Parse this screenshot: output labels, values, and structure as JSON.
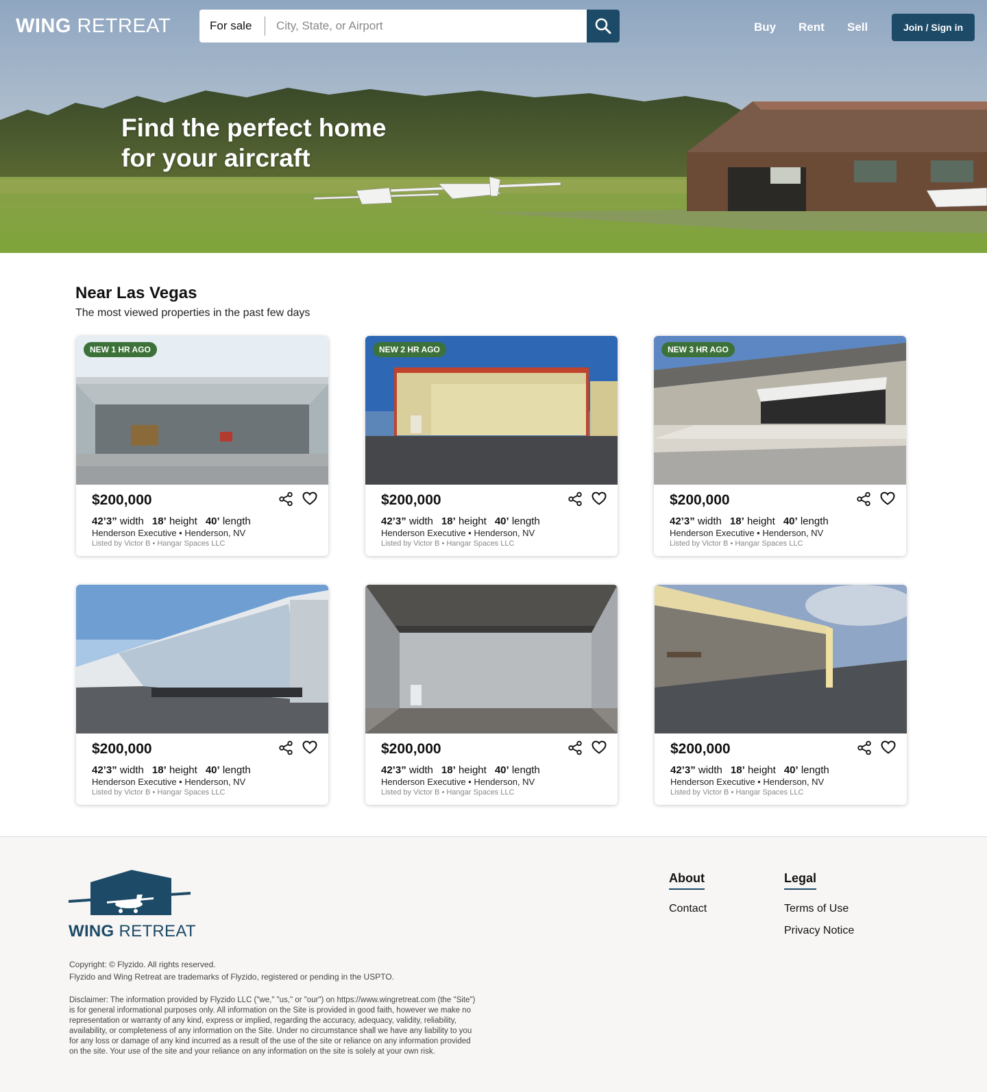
{
  "header": {
    "logo_part1": "WING",
    "logo_part2": "RETREAT",
    "search_mode": "For sale",
    "search_placeholder": "City, State, or Airport",
    "nav": [
      "Buy",
      "Rent",
      "Sell"
    ],
    "join_label": "Join / Sign in"
  },
  "hero": {
    "headline_line1": "Find the perfect home",
    "headline_line2": "for your aircraft"
  },
  "section": {
    "title": "Near Las Vegas",
    "subtitle": "The most viewed properties in the past few days"
  },
  "listings": [
    {
      "badge": "NEW 1 HR AGO",
      "price": "$200,000",
      "width": "42’3”",
      "width_label": "width",
      "height": "18’",
      "height_label": "height",
      "length": "40’",
      "length_label": "length",
      "location": "Henderson Executive • Henderson, NV",
      "lister": "Listed by Victor B • Hangar Spaces LLC"
    },
    {
      "badge": "NEW 2 HR AGO",
      "price": "$200,000",
      "width": "42’3”",
      "width_label": "width",
      "height": "18’",
      "height_label": "height",
      "length": "40’",
      "length_label": "length",
      "location": "Henderson Executive • Henderson, NV",
      "lister": "Listed by Victor B • Hangar Spaces LLC"
    },
    {
      "badge": "NEW 3 HR AGO",
      "price": "$200,000",
      "width": "42’3”",
      "width_label": "width",
      "height": "18’",
      "height_label": "height",
      "length": "40’",
      "length_label": "length",
      "location": "Henderson Executive • Henderson, NV",
      "lister": "Listed by Victor B • Hangar Spaces LLC"
    },
    {
      "badge": "",
      "price": "$200,000",
      "width": "42’3”",
      "width_label": "width",
      "height": "18’",
      "height_label": "height",
      "length": "40’",
      "length_label": "length",
      "location": "Henderson Executive • Henderson, NV",
      "lister": "Listed by Victor B • Hangar Spaces LLC"
    },
    {
      "badge": "",
      "price": "$200,000",
      "width": "42’3”",
      "width_label": "width",
      "height": "18’",
      "height_label": "height",
      "length": "40’",
      "length_label": "length",
      "location": "Henderson Executive • Henderson, NV",
      "lister": "Listed by Victor B • Hangar Spaces LLC"
    },
    {
      "badge": "",
      "price": "$200,000",
      "width": "42’3”",
      "width_label": "width",
      "height": "18’",
      "height_label": "height",
      "length": "40’",
      "length_label": "length",
      "location": "Henderson Executive • Henderson, NV",
      "lister": "Listed by Victor B • Hangar Spaces LLC"
    }
  ],
  "footer": {
    "logo_part1": "WING",
    "logo_part2": "RETREAT",
    "about_heading": "About",
    "about_links": [
      "Contact"
    ],
    "legal_heading": "Legal",
    "legal_links": [
      "Terms of Use",
      "Privacy Notice"
    ],
    "copyright": "Copyright: © Flyzido. All rights reserved.",
    "trademark": "Flyzido and Wing Retreat are trademarks of Flyzido, registered or pending in the USPTO.",
    "disclaimer": "Disclaimer: The information provided by Flyzido LLC (\"we,\" \"us,\" or \"our\") on https://www.wingretreat.com (the \"Site\") is for general informational purposes only. All information on the Site is provided in good faith, however we make no representation or warranty of any kind, express or implied, regarding the accuracy, adequacy, validity, reliability, availability, or completeness of any information on the Site. Under no circumstance shall we have any liability to you for any loss or damage of any kind incurred as a result of the use of the site or reliance on any information provided on the site. Your use of the site and your reliance on any information on the site is solely at your own risk."
  },
  "colors": {
    "brand_navy": "#1d4a67",
    "badge_green": "#3c7239",
    "footer_bg": "#f7f6f4"
  },
  "icons": [
    "search-icon",
    "share-icon",
    "heart-icon",
    "hangar-plane-logo"
  ]
}
